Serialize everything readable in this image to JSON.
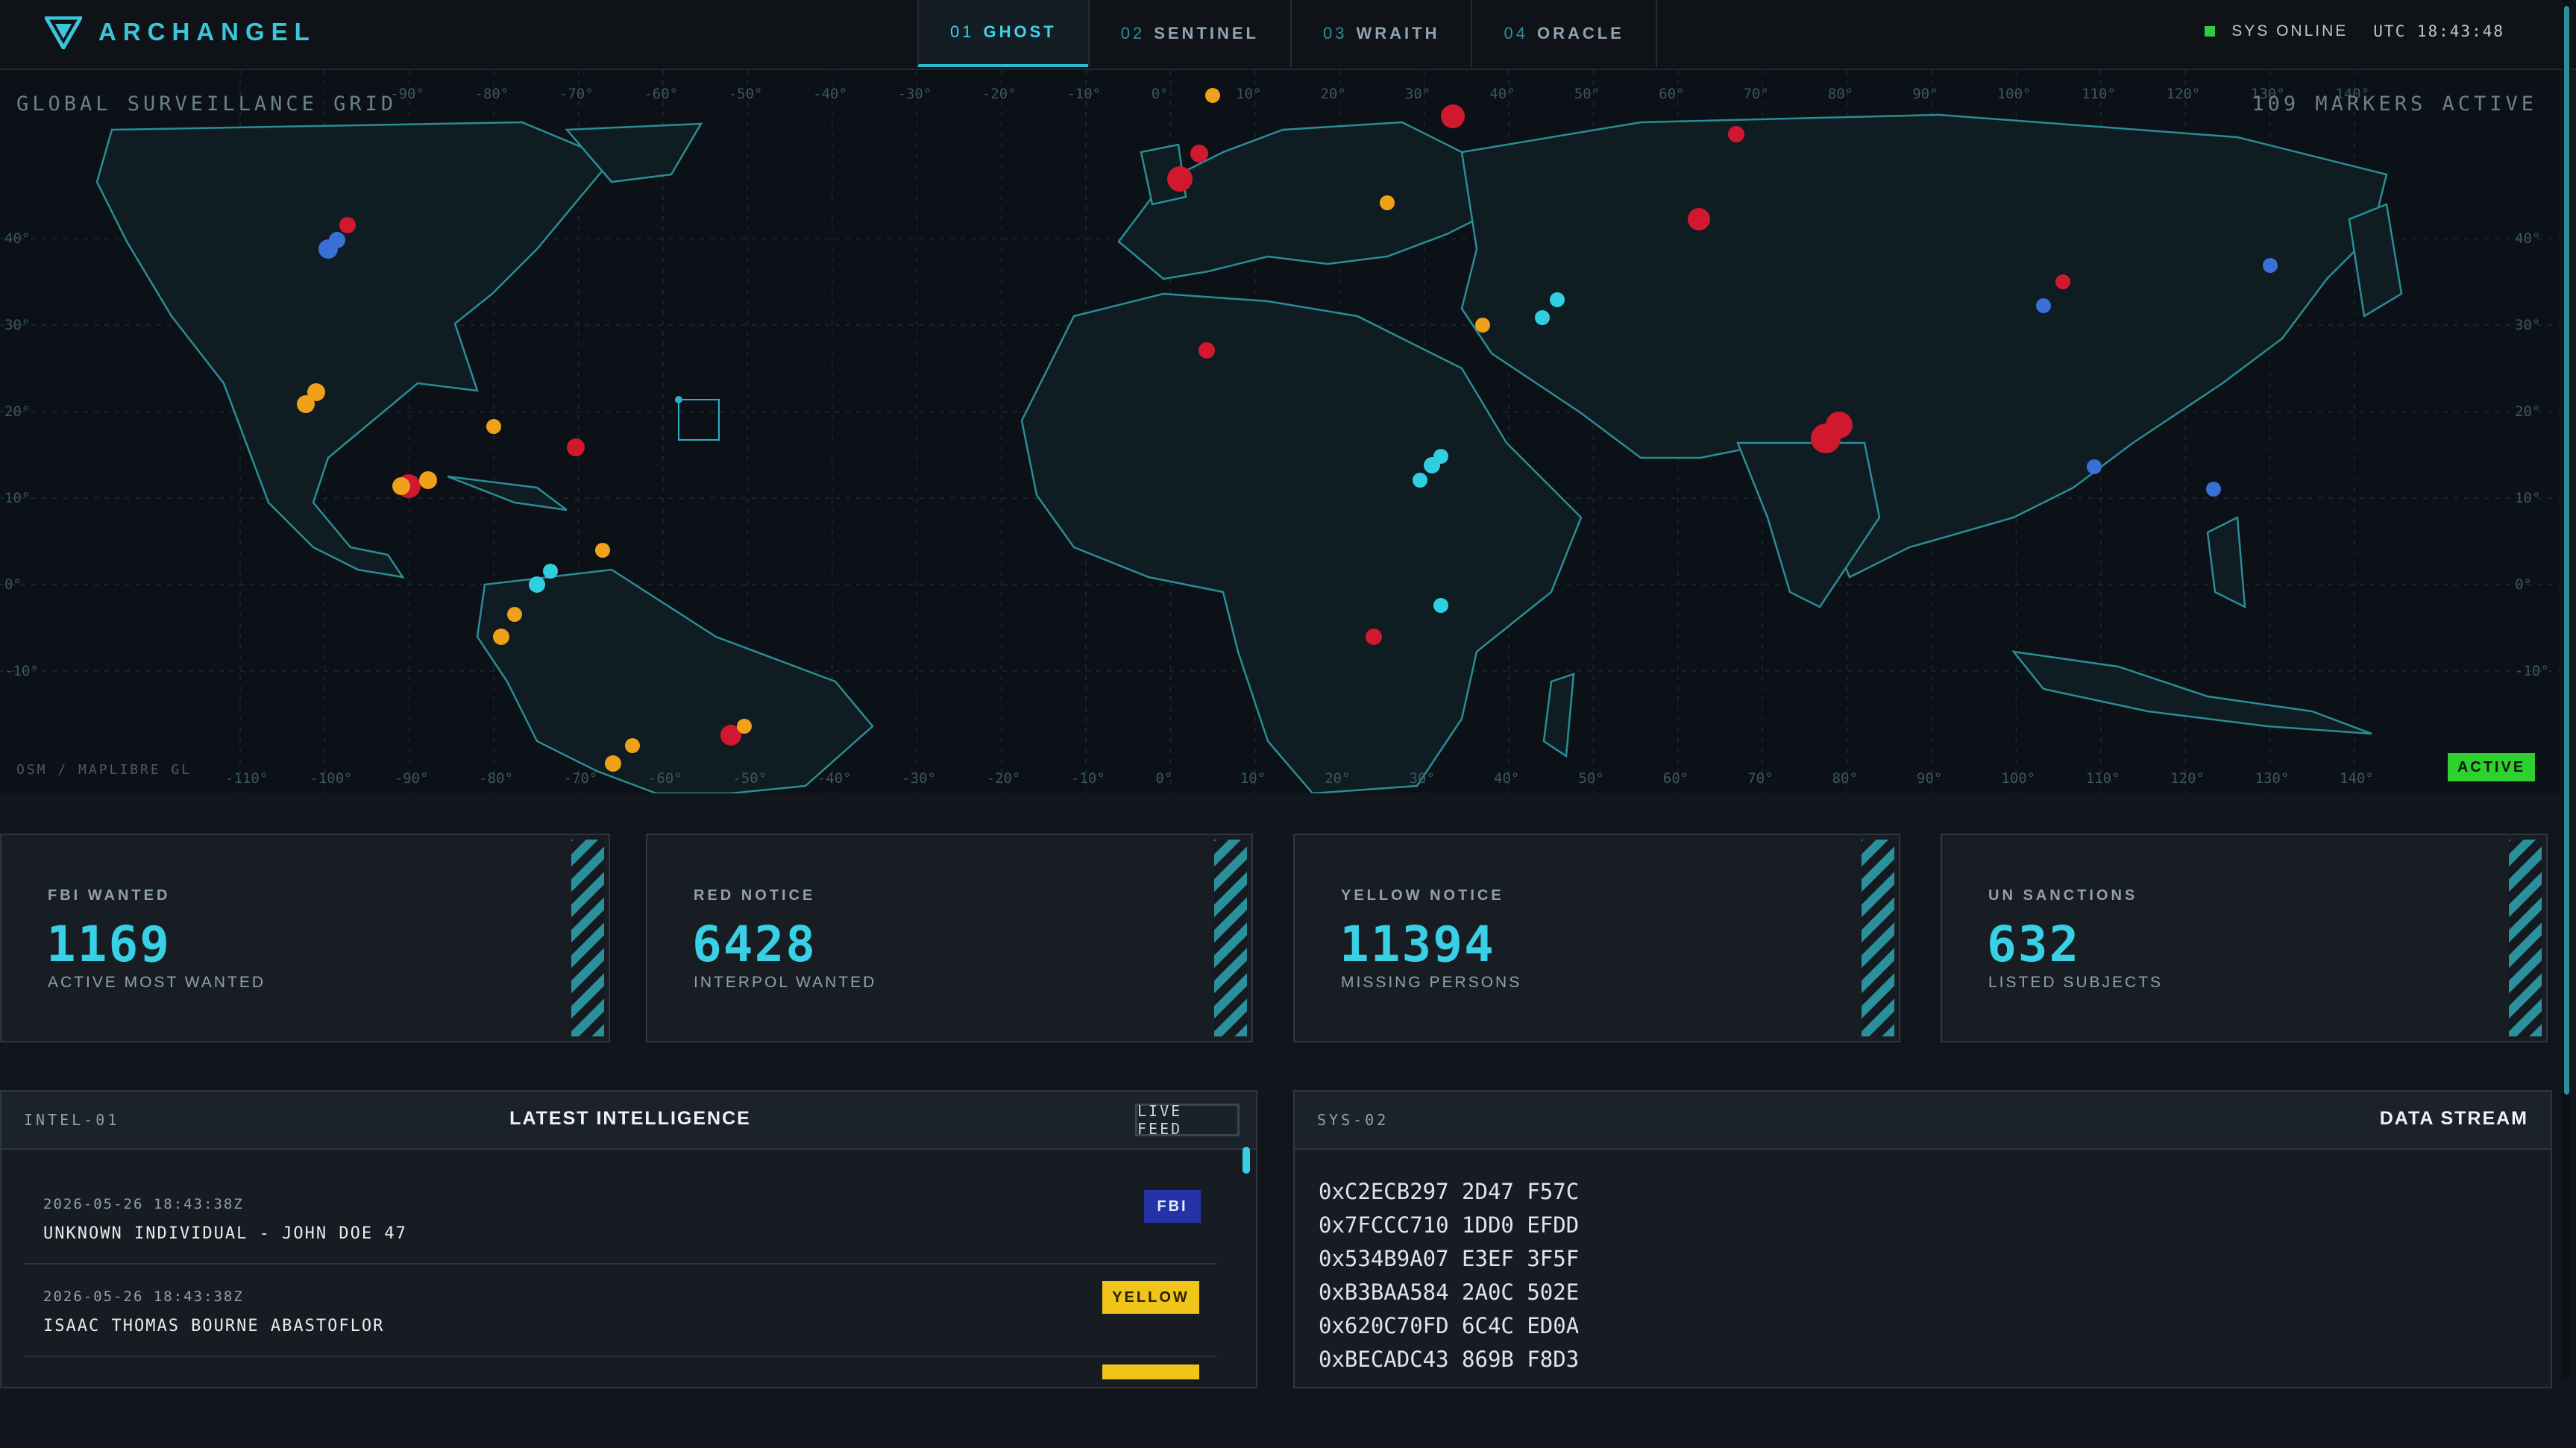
{
  "app": {
    "brand": "ARCHANGEL",
    "accent_color": "#3bc6d8",
    "logo_icon": "chevron-logo-icon"
  },
  "nav": {
    "tabs": [
      {
        "num": "01",
        "label": "GHOST",
        "active": true
      },
      {
        "num": "02",
        "label": "SENTINEL",
        "active": false
      },
      {
        "num": "03",
        "label": "WRAITH",
        "active": false
      },
      {
        "num": "04",
        "label": "ORACLE",
        "active": false
      }
    ]
  },
  "status": {
    "system": "SYS ONLINE",
    "time": "UTC 18:43:48",
    "indicator_color": "#2ecc40"
  },
  "map": {
    "title": "GLOBAL SURVEILLANCE GRID",
    "markers_count": "109 MARKERS ACTIVE",
    "attribution": "OSM / MAPLIBRE GL",
    "active_label": "ACTIVE",
    "lon_labels": [
      "-110°",
      "-100°",
      "-90°",
      "-80°",
      "-70°",
      "-60°",
      "-50°",
      "-40°",
      "-30°",
      "-20°",
      "-10°",
      "0°",
      "10°",
      "20°",
      "30°",
      "40°",
      "50°",
      "60°",
      "70°",
      "80°",
      "90°",
      "100°",
      "110°",
      "120°",
      "130°",
      "140°"
    ],
    "lat_labels": [
      "40°",
      "30°",
      "20°",
      "10°",
      "0°",
      "-10°"
    ],
    "marker_colors": {
      "fbi": "#3a6fd8",
      "red": "#d0182e",
      "yellow": "#f0a019",
      "un": "#2ed0e0"
    }
  },
  "stats": [
    {
      "label": "FBI WANTED",
      "value": "1169",
      "sub": "ACTIVE MOST WANTED"
    },
    {
      "label": "RED NOTICE",
      "value": "6428",
      "sub": "INTERPOL WANTED"
    },
    {
      "label": "YELLOW NOTICE",
      "value": "11394",
      "sub": "MISSING PERSONS"
    },
    {
      "label": "UN SANCTIONS",
      "value": "632",
      "sub": "LISTED SUBJECTS"
    }
  ],
  "intel": {
    "id": "INTEL-01",
    "title": "LATEST INTELLIGENCE",
    "live_label": "LIVE FEED",
    "items": [
      {
        "time": "2026-05-26 18:43:38Z",
        "name": "UNKNOWN INDIVIDUAL - JOHN DOE 47",
        "badge": "FBI"
      },
      {
        "time": "2026-05-26 18:43:38Z",
        "name": "ISAAC THOMAS BOURNE ABASTOFLOR",
        "badge": "YELLOW"
      }
    ]
  },
  "stream": {
    "id": "SYS-02",
    "title": "DATA STREAM",
    "lines": [
      "0xC2ECB297 2D47 F57C",
      "0x7FCCC710 1DD0 EFDD",
      "0x534B9A07 E3EF 3F5F",
      "0xB3BAA584 2A0C 502E",
      "0x620C70FD 6C4C ED0A",
      "0xBECADC43 869B F8D3"
    ]
  }
}
